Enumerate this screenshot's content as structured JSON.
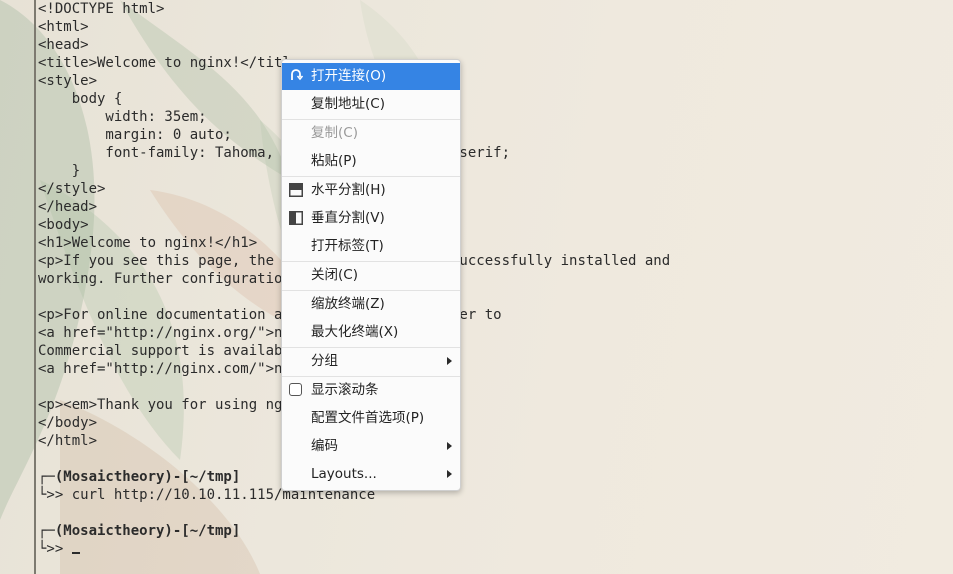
{
  "terminal": {
    "lines": [
      "<!DOCTYPE html>",
      "<html>",
      "<head>",
      "<title>Welcome to nginx!</title>",
      "<style>",
      "    body {",
      "        width: 35em;",
      "        margin: 0 auto;",
      "        font-family: Tahoma, Verdana, Arial, sans-serif;",
      "    }",
      "</style>",
      "</head>",
      "<body>",
      "<h1>Welcome to nginx!</h1>",
      "<p>If you see this page, the nginx web server is successfully installed and",
      "working. Further configuration is required.</p>",
      "",
      "<p>For online documentation and support please refer to",
      "<a href=\"http://nginx.org/\">nginx.org</a>.<br/>",
      "Commercial support is available at",
      "<a href=\"http://nginx.com/\">nginx.com</a>.</p>",
      "",
      "<p><em>Thank you for using nginx.</em></p>",
      "</body>",
      "</html>",
      "",
      "┌─(Mosaictheory)-[~/tmp]",
      "└>> curl http://10.10.11.115/maintenance",
      "",
      "┌─(Mosaictheory)-[~/tmp]",
      "└>> "
    ]
  },
  "context_menu": {
    "items": [
      {
        "label": "打开连接(O)",
        "icon": "open-link-icon",
        "state": "active"
      },
      {
        "label": "复制地址(C)"
      },
      {
        "separator": true
      },
      {
        "label": "复制(C)",
        "state": "disabled"
      },
      {
        "label": "粘贴(P)"
      },
      {
        "separator": true
      },
      {
        "label": "水平分割(H)",
        "icon": "split-horizontal-icon"
      },
      {
        "label": "垂直分割(V)",
        "icon": "split-vertical-icon"
      },
      {
        "label": "打开标签(T)"
      },
      {
        "separator": true
      },
      {
        "label": "关闭(C)"
      },
      {
        "separator": true
      },
      {
        "label": "缩放终端(Z)"
      },
      {
        "label": "最大化终端(X)"
      },
      {
        "separator": true
      },
      {
        "label": "分组",
        "submenu": true
      },
      {
        "separator": true
      },
      {
        "label": "显示滚动条",
        "checkbox": true,
        "checked": false
      },
      {
        "label": "配置文件首选项(P)"
      },
      {
        "label": "编码",
        "submenu": true
      },
      {
        "label": "Layouts...",
        "submenu": true
      }
    ]
  },
  "colors": {
    "menu_highlight": "#3584e4",
    "terminal_text": "#2b2b2b"
  }
}
